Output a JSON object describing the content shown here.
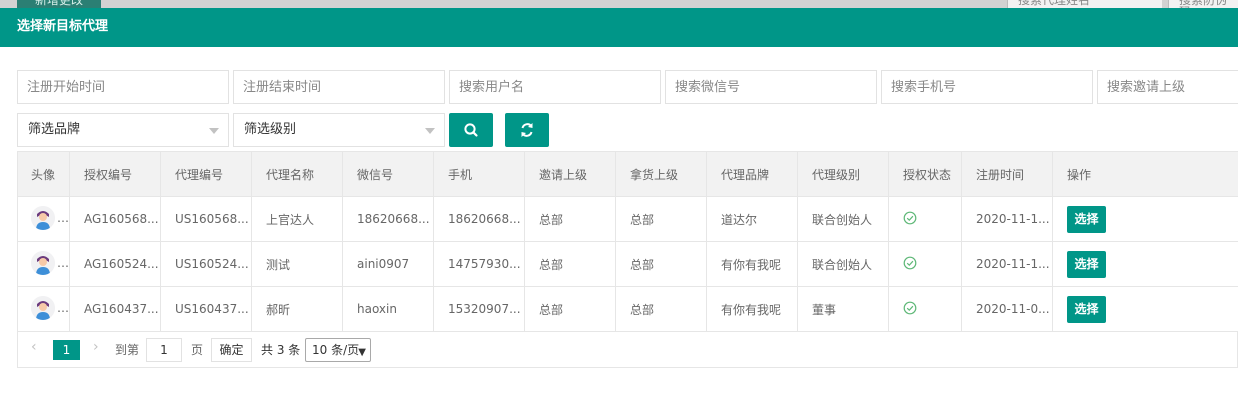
{
  "background": {
    "left_tab": "新增更改",
    "right_box1": "搜索代理姓名",
    "right_box2": "搜索防伪码"
  },
  "modal": {
    "title": "选择新目标代理"
  },
  "filters": {
    "reg_start": "注册开始时间",
    "reg_end": "注册结束时间",
    "username": "搜索用户名",
    "wechat": "搜索微信号",
    "phone": "搜索手机号",
    "inviter": "搜索邀请上级",
    "brand_select": "筛选品牌",
    "level_select": "筛选级别",
    "search_icon": "search-icon",
    "refresh_icon": "refresh-icon"
  },
  "table": {
    "headers": [
      "头像",
      "授权编号",
      "代理编号",
      "代理名称",
      "微信号",
      "手机",
      "邀请上级",
      "拿货上级",
      "代理品牌",
      "代理级别",
      "授权状态",
      "注册时间",
      "操作"
    ],
    "rows": [
      {
        "auth_no": "AG160568...",
        "agent_no": "US160568...",
        "name": "上官达人",
        "wechat": "18620668...",
        "phone": "18620668...",
        "inviter": "总部",
        "supplier": "总部",
        "brand": "道达尔",
        "level": "联合创始人",
        "status": "check-icon",
        "reg_time": "2020-11-1...",
        "action": "选择"
      },
      {
        "auth_no": "AG160524...",
        "agent_no": "US160524...",
        "name": "测试",
        "wechat": "aini0907",
        "phone": "14757930...",
        "inviter": "总部",
        "supplier": "总部",
        "brand": "有你有我呢",
        "level": "联合创始人",
        "status": "check-icon",
        "reg_time": "2020-11-1...",
        "action": "选择"
      },
      {
        "auth_no": "AG160437...",
        "agent_no": "US160437...",
        "name": "郝昕",
        "wechat": "haoxin",
        "phone": "15320907...",
        "inviter": "总部",
        "supplier": "总部",
        "brand": "有你有我呢",
        "level": "董事",
        "status": "check-icon",
        "reg_time": "2020-11-0...",
        "action": "选择"
      }
    ]
  },
  "pagination": {
    "current_page": "1",
    "goto_label": "到第",
    "goto_value": "1",
    "page_unit": "页",
    "confirm": "确定",
    "total": "共 3 条",
    "page_size": "10 条/页"
  },
  "colors": {
    "accent": "#009688",
    "status_ok": "#5fb878"
  }
}
